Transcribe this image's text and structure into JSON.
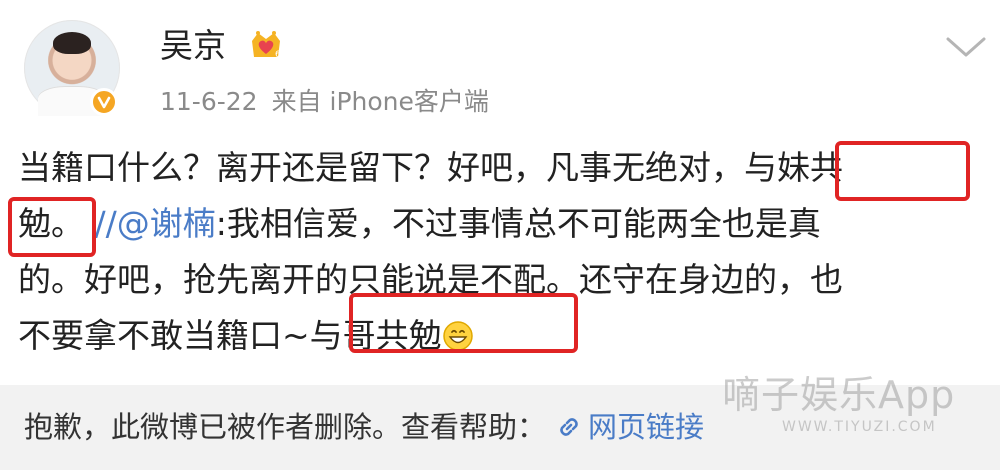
{
  "post": {
    "username": "吴京",
    "timestamp": "11-6-22",
    "source": "来自 iPhone客户端",
    "lines": [
      {
        "text": "当籍口什么？离开还是留下？好吧，凡事无绝对，与妹共"
      },
      {
        "text_before": "勉。",
        "mention": " //@谢楠",
        "text_after": ":我相信爱，不过事情总不可能两全也是真"
      },
      {
        "text": "的。好吧，抢先离开的只能说是不配。还守在身边的，也"
      },
      {
        "text": "不要拿不敢当籍口~与哥共勉"
      }
    ],
    "icons": {
      "verified": "verified-badge-icon",
      "member": "crown-heart-icon",
      "more": "chevron-down-icon",
      "emoji": "grinning-emoji-icon"
    }
  },
  "footer": {
    "notice": "抱歉，此微博已被作者删除。查看帮助：",
    "link_icon": "link-icon",
    "link_label": "网页链接"
  },
  "watermark": {
    "text": "嘀子娱乐App",
    "sub": "WWW.TIYUZI.COM"
  },
  "colors": {
    "highlight_box": "#e02424",
    "mention": "#4a7cc7",
    "verified": "#f5a623",
    "footer_bg": "#f2f2f2"
  }
}
